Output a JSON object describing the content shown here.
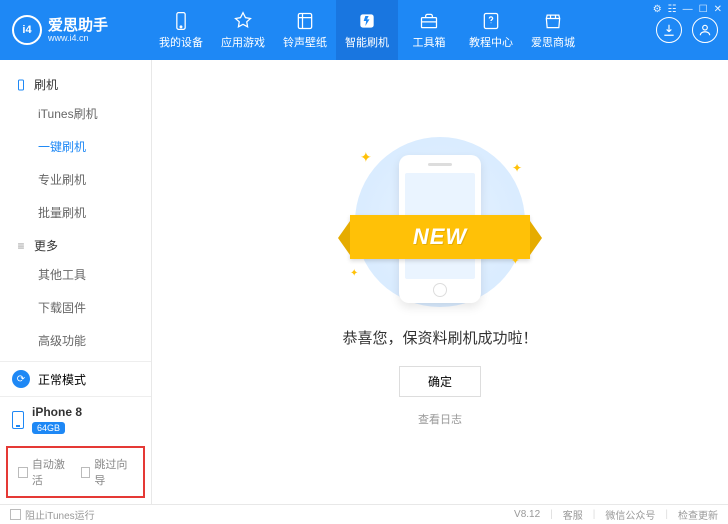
{
  "brand": {
    "name": "爱思助手",
    "url": "www.i4.cn",
    "logo_text": "i4"
  },
  "win": {
    "settings": "⚙",
    "skin": "☷",
    "min": "—",
    "max": "☐",
    "close": "✕"
  },
  "nav": [
    {
      "label": "我的设备",
      "icon": "phone"
    },
    {
      "label": "应用游戏",
      "icon": "apps"
    },
    {
      "label": "铃声壁纸",
      "icon": "media"
    },
    {
      "label": "智能刷机",
      "icon": "flash",
      "active": true
    },
    {
      "label": "工具箱",
      "icon": "tools"
    },
    {
      "label": "教程中心",
      "icon": "help"
    },
    {
      "label": "爱思商城",
      "icon": "shop"
    }
  ],
  "sidebar": {
    "groups": [
      {
        "title": "刷机",
        "icon": "phone-icon",
        "items": [
          "iTunes刷机",
          "一键刷机",
          "专业刷机",
          "批量刷机"
        ],
        "activeIndex": 1
      },
      {
        "title": "更多",
        "icon": "more-icon",
        "items": [
          "其他工具",
          "下载固件",
          "高级功能"
        ]
      }
    ],
    "mode": "正常模式",
    "device": {
      "name": "iPhone 8",
      "storage": "64GB"
    },
    "checks": {
      "auto_activate": "自动激活",
      "skip_guide": "跳过向导"
    }
  },
  "main": {
    "ribbon": "NEW",
    "message": "恭喜您，保资料刷机成功啦！",
    "ok": "确定",
    "log": "查看日志"
  },
  "footer": {
    "block_itunes": "阻止iTunes运行",
    "version": "V8.12",
    "support": "客服",
    "wechat": "微信公众号",
    "update": "检查更新"
  }
}
